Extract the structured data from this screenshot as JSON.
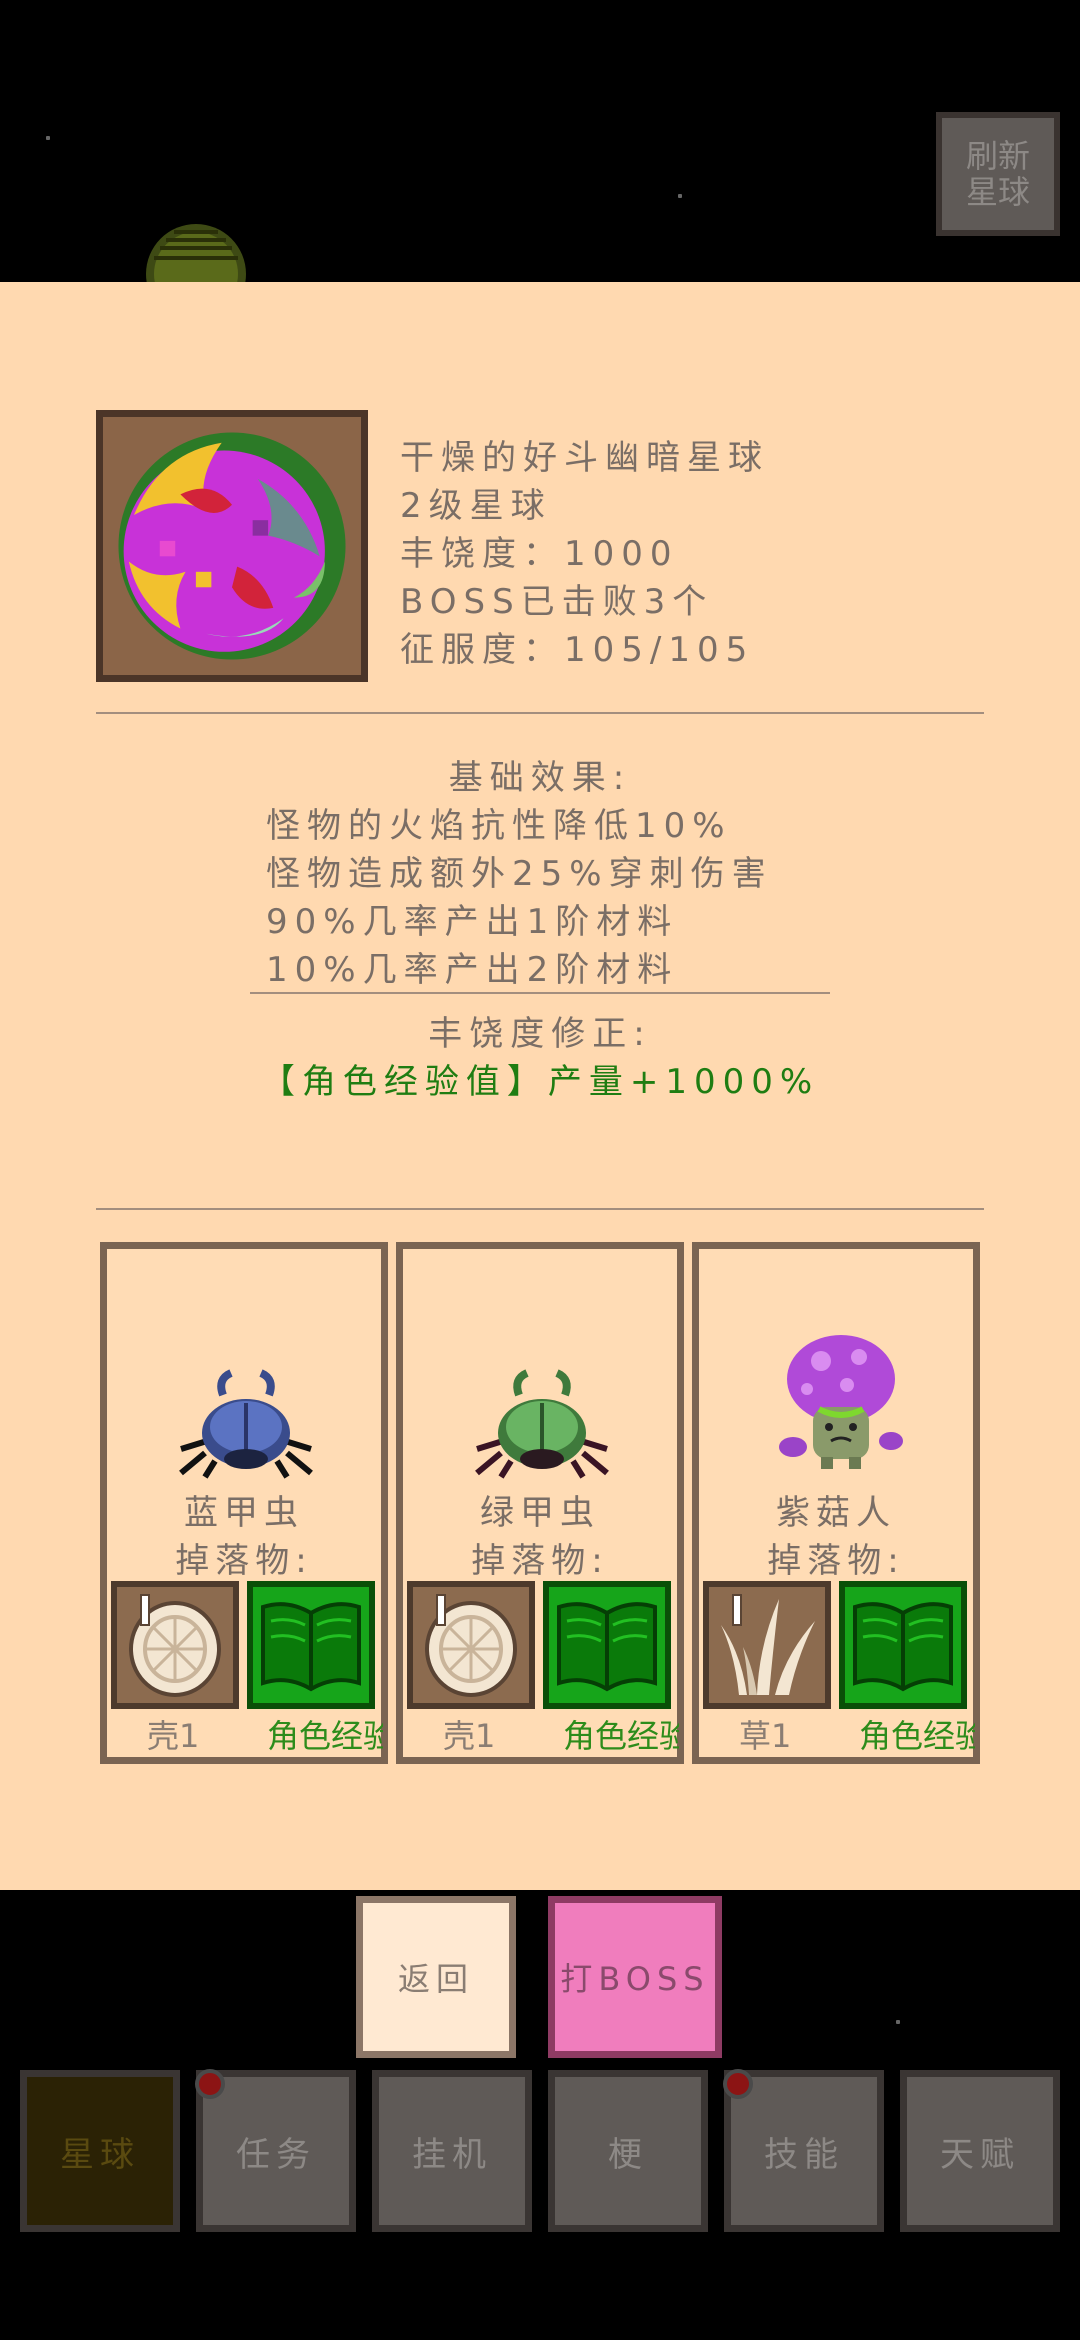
{
  "refresh_button": "刷新\n星球",
  "planet": {
    "name": "干燥的好斗幽暗星球",
    "level": "2级星球",
    "richness": "丰饶度：1000",
    "boss_defeated": "BOSS已击败3个",
    "conquest": "征服度：105/105"
  },
  "base_effects": {
    "title": "基础效果:",
    "lines": [
      "怪物的火焰抗性降低10%",
      "怪物造成额外25%穿刺伤害",
      "90%几率产出1阶材料",
      "10%几率产出2阶材料"
    ]
  },
  "richness_modifier": {
    "title": "丰饶度修正:",
    "line": "【角色经验值】产量+1000%"
  },
  "monsters": [
    {
      "name": "蓝甲虫",
      "drops_label": "掉落物:",
      "drops": [
        {
          "label": "壳1",
          "icon": "shell-icon"
        },
        {
          "label": "角色经验",
          "icon": "book-icon"
        }
      ]
    },
    {
      "name": "绿甲虫",
      "drops_label": "掉落物:",
      "drops": [
        {
          "label": "壳1",
          "icon": "shell-icon"
        },
        {
          "label": "角色经验",
          "icon": "book-icon"
        }
      ]
    },
    {
      "name": "紫菇人",
      "drops_label": "掉落物:",
      "drops": [
        {
          "label": "草1",
          "icon": "grass-icon"
        },
        {
          "label": "角色经验",
          "icon": "book-icon"
        }
      ]
    }
  ],
  "actions": {
    "back": "返回",
    "fight_boss": "打BOSS"
  },
  "nav": {
    "tabs": [
      {
        "label": "星球"
      },
      {
        "label": "任务"
      },
      {
        "label": "挂机"
      },
      {
        "label": "梗"
      },
      {
        "label": "技能"
      },
      {
        "label": "天赋"
      }
    ]
  },
  "colors": {
    "panel": "#ffd9b0",
    "boss_button": "#f07dbd",
    "modifier_text": "#1f7d12"
  }
}
